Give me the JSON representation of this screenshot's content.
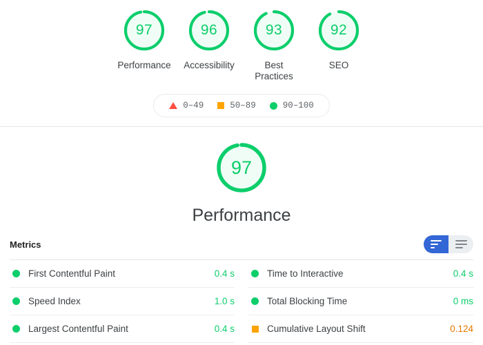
{
  "summary": {
    "gauges": [
      {
        "score": "97",
        "label": "Performance",
        "color": "#0cce6b",
        "bg": "#f0fdf6"
      },
      {
        "score": "96",
        "label": "Accessibility",
        "color": "#0cce6b",
        "bg": "#f0fdf6"
      },
      {
        "score": "93",
        "label": "Best Practices",
        "color": "#0cce6b",
        "bg": "#f0fdf6"
      },
      {
        "score": "92",
        "label": "SEO",
        "color": "#0cce6b",
        "bg": "#f0fdf6"
      }
    ],
    "legend": [
      {
        "icon": "triangle-icon",
        "range": "0–49",
        "color": "#ff4e42"
      },
      {
        "icon": "square-icon",
        "range": "50–89",
        "color": "#ffa400"
      },
      {
        "icon": "circle-icon",
        "range": "90–100",
        "color": "#0cce6b"
      }
    ]
  },
  "category": {
    "score": "97",
    "title": "Performance",
    "color": "#0cce6b",
    "bg": "#f0fdf6"
  },
  "metrics": {
    "heading": "Metrics",
    "toggle": {
      "active_name": "filter-view-toggle",
      "inactive_name": "list-view-toggle"
    },
    "items": [
      {
        "name": "First Contentful Paint",
        "value": "0.4 s",
        "rating": "green"
      },
      {
        "name": "Time to Interactive",
        "value": "0.4 s",
        "rating": "green"
      },
      {
        "name": "Speed Index",
        "value": "1.0 s",
        "rating": "green"
      },
      {
        "name": "Total Blocking Time",
        "value": "0 ms",
        "rating": "green"
      },
      {
        "name": "Largest Contentful Paint",
        "value": "0.4 s",
        "rating": "green"
      },
      {
        "name": "Cumulative Layout Shift",
        "value": "0.124",
        "rating": "orange"
      }
    ]
  }
}
